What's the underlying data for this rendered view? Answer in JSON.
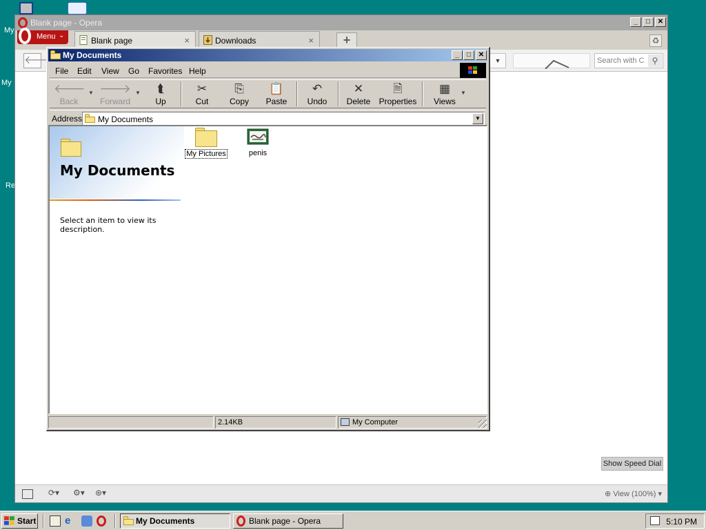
{
  "desktop": {
    "labels": [
      "My",
      "My",
      "Re"
    ]
  },
  "opera": {
    "title": "Blank page - Opera",
    "menu_label": "Menu",
    "tabs": [
      {
        "label": "Blank page",
        "close": "×"
      },
      {
        "label": "Downloads",
        "close": "×"
      }
    ],
    "new_tab": "+",
    "search_placeholder": "Search with C",
    "speed_dial_label": "Show Speed Dial",
    "zoom_label": "View (100%)"
  },
  "explorer": {
    "title": "My Documents",
    "menu": [
      "File",
      "Edit",
      "View",
      "Go",
      "Favorites",
      "Help"
    ],
    "toolbar": {
      "back": "Back",
      "forward": "Forward",
      "up": "Up",
      "cut": "Cut",
      "copy": "Copy",
      "paste": "Paste",
      "undo": "Undo",
      "delete": "Delete",
      "properties": "Properties",
      "views": "Views"
    },
    "address_label": "Address",
    "address_value": "My Documents",
    "webview": {
      "title": "My Documents",
      "description": "Select an item to view its description."
    },
    "items": [
      {
        "label": "My Pictures",
        "icon": "folder-icon"
      },
      {
        "label": "penis",
        "icon": "picture-file-icon"
      }
    ],
    "status": {
      "size": "2.14KB",
      "zone": "My Computer"
    }
  },
  "taskbar": {
    "start_label": "Start",
    "tasks": [
      {
        "label": "My Documents"
      },
      {
        "label": "Blank page - Opera"
      }
    ],
    "clock": "5:10 PM"
  },
  "colors": {
    "desktop": "#008080",
    "title_active_start": "#0a246a",
    "title_active_end": "#a6caf0",
    "opera_red": "#b81414"
  }
}
